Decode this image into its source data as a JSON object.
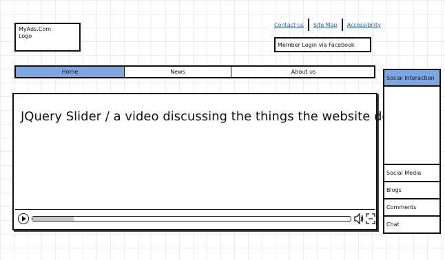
{
  "logo": {
    "line1": "MyAds.Com",
    "line2": "Logo"
  },
  "top_links": {
    "contact": "Contact us",
    "sitemap": "Site Map",
    "accessibility": "Accessibility",
    "link_color": "#2a5db0"
  },
  "login": {
    "label": "Member Login via Facebook"
  },
  "nav": {
    "active_color": "#7ea6e0",
    "tabs": [
      {
        "label": "Home",
        "active": true
      },
      {
        "label": "News",
        "active": false
      },
      {
        "label": "About us",
        "active": false
      }
    ]
  },
  "video": {
    "title": "JQuery Slider / a video discussing the things the website does",
    "progress_fraction": 0.13,
    "icons": [
      "play-icon",
      "volume-icon",
      "fullscreen-icon"
    ]
  },
  "sidebar": {
    "header": "Social Interaction",
    "header_color": "#7ea6e0",
    "items": [
      {
        "label": "Social Media"
      },
      {
        "label": "Blogs"
      },
      {
        "label": "Comments"
      },
      {
        "label": "Chat"
      }
    ]
  }
}
